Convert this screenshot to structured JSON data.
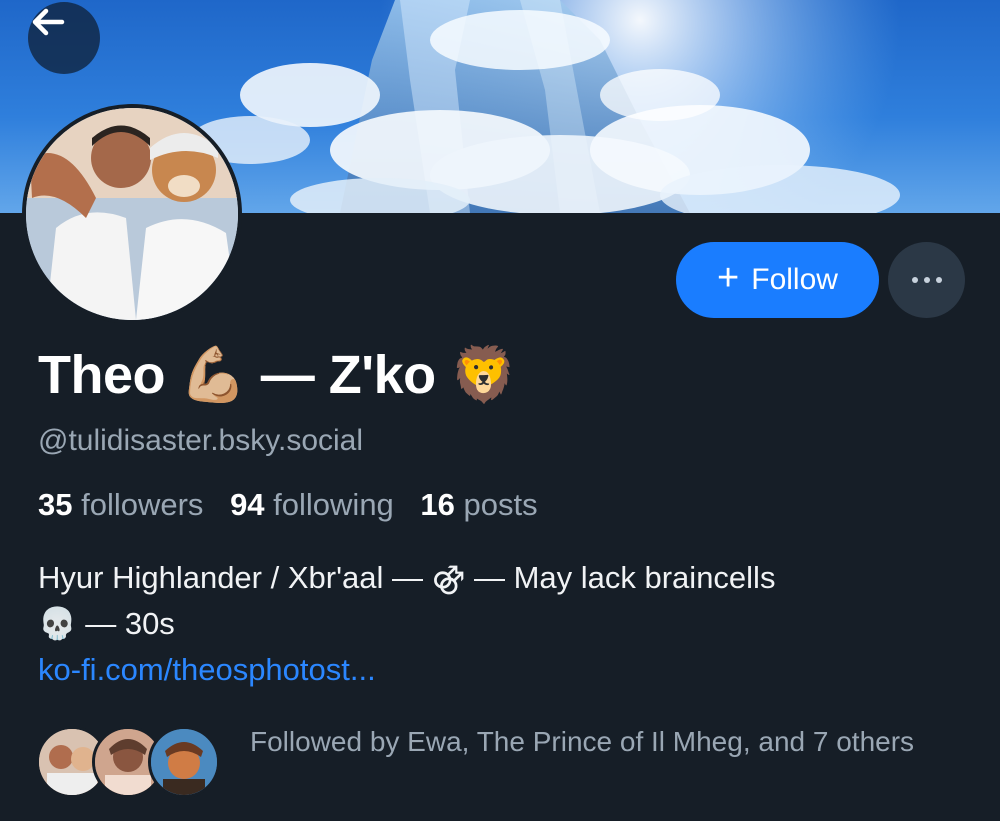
{
  "header": {
    "back_icon": "arrow-left-icon"
  },
  "profile": {
    "name_part1": "Theo",
    "name_emoji1": "💪🏼",
    "name_part2": "— Z'ko",
    "name_emoji2": "🦁",
    "handle": "@tulidisaster.bsky.social"
  },
  "actions": {
    "follow_plus": "+",
    "follow_label": "Follow",
    "more_icon": "ellipsis-icon"
  },
  "stats": {
    "followers_count": "35",
    "followers_label": "followers",
    "following_count": "94",
    "following_label": "following",
    "posts_count": "16",
    "posts_label": "posts"
  },
  "bio": {
    "line1": "Hyur Highlander / Xbr'aal — ⚣ — May lack braincells",
    "line2": "💀 — 30s",
    "link": "ko-fi.com/theosphotost..."
  },
  "followed_by": {
    "text": "Followed by Ewa, The Prince of Il Mheg, and 7 others"
  },
  "colors": {
    "background": "#161e27",
    "accent": "#1a7dff",
    "link": "#2b87ff",
    "muted_text": "#9aa7b4"
  }
}
